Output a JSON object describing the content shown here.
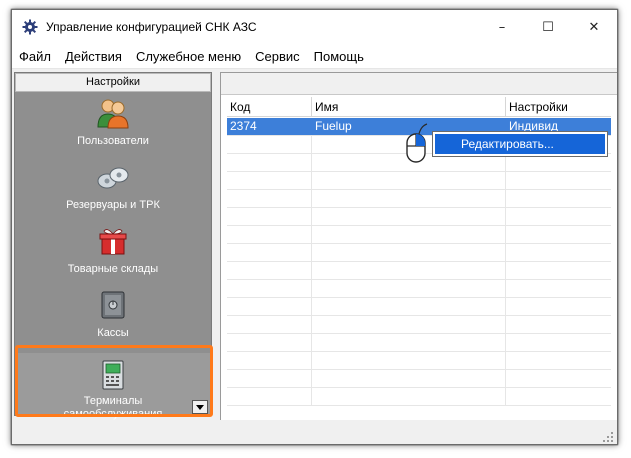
{
  "window": {
    "title": "Управление конфигурацией СНК АЗС",
    "icon": "gear-icon",
    "buttons": {
      "minimize": "–",
      "maximize": "☐",
      "close": "✕"
    }
  },
  "menu": {
    "items": [
      "Файл",
      "Действия",
      "Служебное меню",
      "Сервис",
      "Помощь"
    ]
  },
  "sidebar": {
    "header": "Настройки",
    "items": [
      {
        "label": "Пользователи",
        "icon": "users-icon"
      },
      {
        "label": "Резервуары и ТРК",
        "icon": "tanks-icon"
      },
      {
        "label": "Товарные склады",
        "icon": "warehouse-icon"
      },
      {
        "label": "Кассы",
        "icon": "safe-icon"
      },
      {
        "label_line1": "Терминалы",
        "label_line2": "самообслуживания",
        "icon": "terminal-icon"
      }
    ],
    "highlight_color": "#ff7a1a"
  },
  "grid": {
    "columns": [
      "Код",
      "Имя",
      "Настройки"
    ],
    "rows": [
      {
        "code": "2374",
        "name": "Fuelup",
        "settings": "Индивид"
      }
    ],
    "selection_color": "#3d7fd9"
  },
  "context_menu": {
    "items": [
      "Редактировать..."
    ],
    "highlight_color": "#1565d8"
  }
}
